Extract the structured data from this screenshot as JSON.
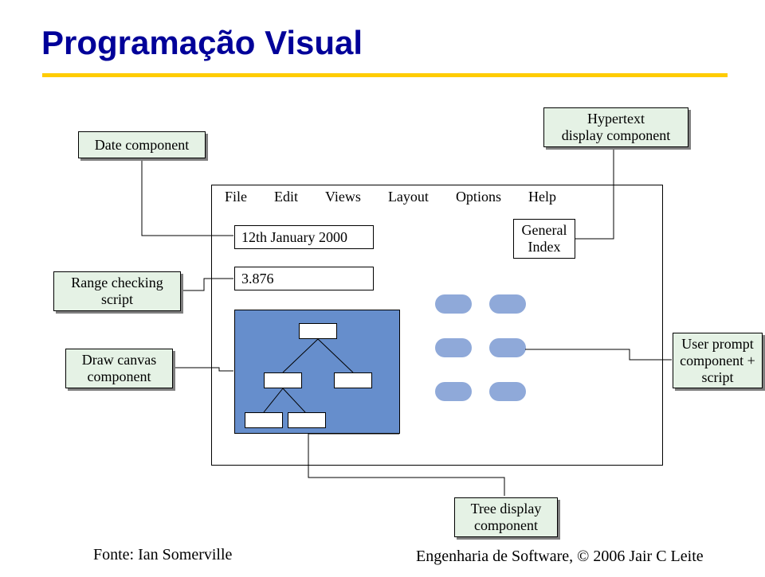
{
  "title": "Programação Visual",
  "labels": {
    "date_component": "Date component",
    "hypertext_line1": "Hypertext",
    "hypertext_line2": "display component",
    "range_line1": "Range checking",
    "range_line2": "script",
    "draw_line1": "Draw canvas",
    "draw_line2": "component",
    "user_line1": "User prompt",
    "user_line2": "component +",
    "user_line3": "script",
    "tree_line1": "Tree display",
    "tree_line2": "component"
  },
  "menu": {
    "file": "File",
    "edit": "Edit",
    "views": "Views",
    "layout": "Layout",
    "options": "Options",
    "help": "Help"
  },
  "fields": {
    "date_value": "12th January 2000",
    "num_value": "3.876",
    "gi_line1": "General",
    "gi_line2": "Index"
  },
  "footer": {
    "source": "Fonte: Ian Somerville",
    "copyright": "Engenharia de Software, © 2006 Jair C Leite"
  }
}
